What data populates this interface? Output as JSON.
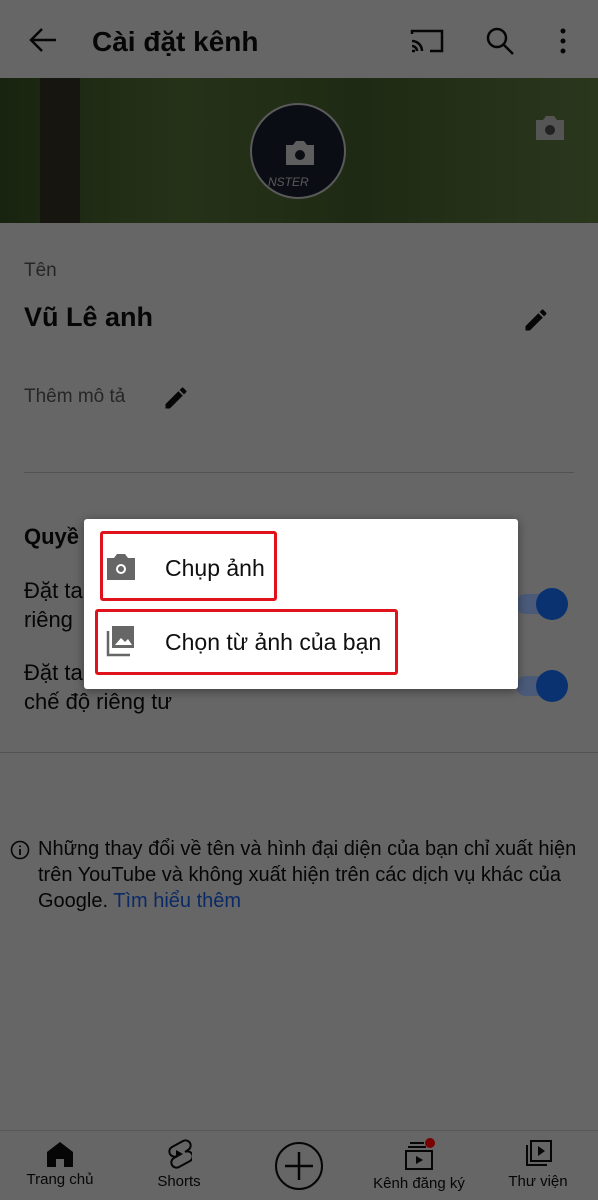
{
  "header": {
    "title": "Cài đặt kênh",
    "back_icon": "arrow-left-icon",
    "cast_icon": "cast-icon",
    "search_icon": "search-icon",
    "more_icon": "more-vert-icon"
  },
  "profile": {
    "name_label": "Tên",
    "name_value": "Vũ Lê anh",
    "description_placeholder": "Thêm mô tả",
    "avatar_text": "NSTER"
  },
  "privacy": {
    "heading_fragment": "Quyề",
    "item1_line1": "Đặt ta",
    "item1_line2": "riêng",
    "item2_line1": "Đặt ta",
    "item2_line2": "chế độ riêng tư",
    "item1_enabled": true,
    "item2_enabled": true
  },
  "info": {
    "text": "Những thay đổi về tên và hình đại diện của bạn chỉ xuất hiện trên YouTube và không xuất hiện trên các dịch vụ khác của Google. ",
    "link": "Tìm hiểu thêm"
  },
  "bottom_nav": [
    {
      "label": "Trang chủ"
    },
    {
      "label": "Shorts"
    },
    {
      "label": ""
    },
    {
      "label": "Kênh đăng ký"
    },
    {
      "label": "Thư viện"
    }
  ],
  "dialog": {
    "options": [
      {
        "label": "Chụp ảnh",
        "icon": "camera-icon"
      },
      {
        "label": "Chọn từ ảnh của bạn",
        "icon": "photo-library-icon"
      }
    ]
  },
  "colors": {
    "accent": "#065fd4",
    "highlight": "#e0121b",
    "notification": "#cc0000"
  }
}
